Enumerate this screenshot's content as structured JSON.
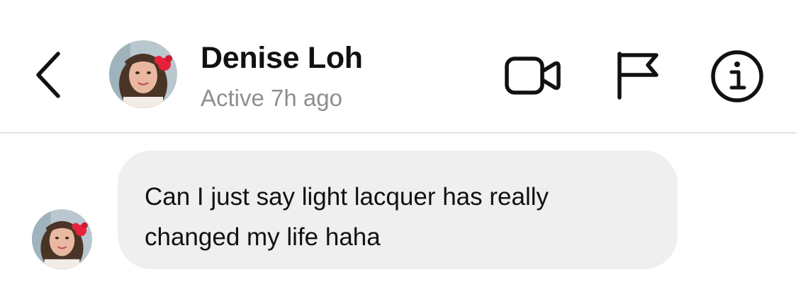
{
  "header": {
    "contact_name": "Denise Loh",
    "status": "Active 7h ago",
    "icons": {
      "back": "chevron-left-icon",
      "video": "video-camera-icon",
      "report": "flag-icon",
      "info": "info-circle-icon"
    }
  },
  "conversation": {
    "messages": [
      {
        "sender": "Denise Loh",
        "direction": "incoming",
        "text": "Can I just say light lacquer has really\nchanged my life haha"
      }
    ]
  },
  "colors": {
    "background": "#ffffff",
    "bubble": "#efefef",
    "primary_text": "#111111",
    "secondary_text": "#8e8e93",
    "divider": "#e3e3e6",
    "avatar_flower": "#e8213a"
  }
}
